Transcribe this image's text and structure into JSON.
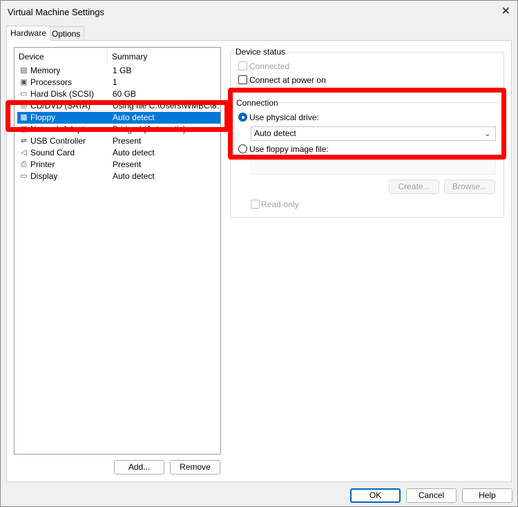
{
  "window": {
    "title": "Virtual Machine Settings",
    "close_icon": "close-icon"
  },
  "tabs": [
    {
      "label": "Hardware",
      "active": true
    },
    {
      "label": "Options",
      "active": false
    }
  ],
  "device_list": {
    "columns": [
      "Device",
      "Summary"
    ],
    "rows": [
      {
        "icon": "memory-icon",
        "glyph": "▤",
        "device": "Memory",
        "summary": "1 GB"
      },
      {
        "icon": "processor-icon",
        "glyph": "▣",
        "device": "Processors",
        "summary": "1"
      },
      {
        "icon": "hard-disk-icon",
        "glyph": "▭",
        "device": "Hard Disk (SCSI)",
        "summary": "60 GB"
      },
      {
        "icon": "cd-dvd-icon",
        "glyph": "◎",
        "device": "CD/DVD (SATA)",
        "summary": "Using file C:\\Users\\WMBC\\8…"
      },
      {
        "icon": "floppy-icon",
        "glyph": "▦",
        "device": "Floppy",
        "summary": "Auto detect",
        "selected": true
      },
      {
        "icon": "network-adapter-icon",
        "glyph": "▥",
        "device": "Network Adapter",
        "summary": "Bridged (Automatic)"
      },
      {
        "icon": "usb-icon",
        "glyph": "⇌",
        "device": "USB Controller",
        "summary": "Present"
      },
      {
        "icon": "sound-card-icon",
        "glyph": "◁",
        "device": "Sound Card",
        "summary": "Auto detect"
      },
      {
        "icon": "printer-icon",
        "glyph": "⎙",
        "device": "Printer",
        "summary": "Present"
      },
      {
        "icon": "display-icon",
        "glyph": "▭",
        "device": "Display",
        "summary": "Auto detect"
      }
    ],
    "add_label": "Add...",
    "remove_label": "Remove"
  },
  "device_status": {
    "title": "Device status",
    "connected": {
      "label": "Connected",
      "checked": false,
      "disabled": true
    },
    "connect_at_power_on": {
      "label": "Connect at power on",
      "checked": false
    }
  },
  "connection": {
    "title": "Connection",
    "physical": {
      "label": "Use physical drive:",
      "selected": true
    },
    "drive_value": "Auto detect",
    "image": {
      "label": "Use floppy image file:",
      "selected": false
    },
    "image_value": "",
    "create_label": "Create...",
    "browse_label": "Browse...",
    "readonly_label": "Read-only"
  },
  "footer": {
    "ok": "OK",
    "cancel": "Cancel",
    "help": "Help"
  },
  "highlight_color": "#ff0000",
  "selection_color": "#0078d7"
}
